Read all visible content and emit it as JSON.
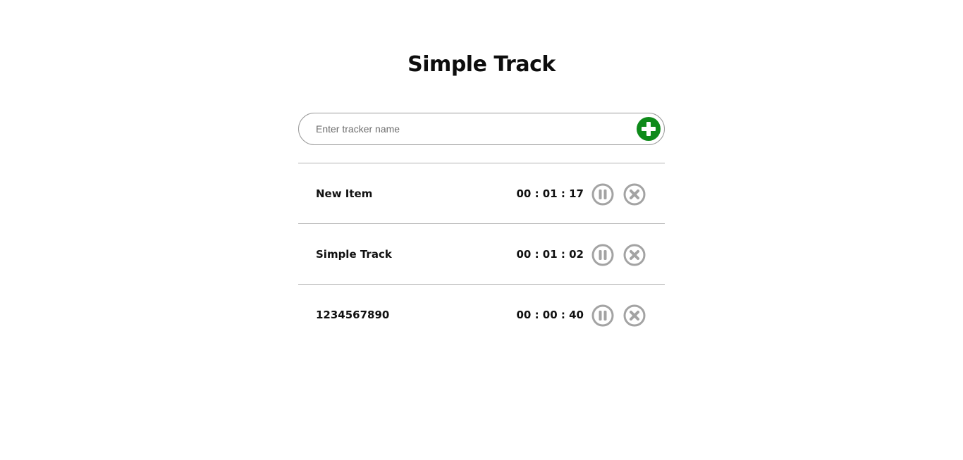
{
  "app": {
    "title": "Simple Track"
  },
  "form": {
    "placeholder": "Enter tracker name",
    "value": "",
    "add_icon": "plus-circle-icon",
    "add_color": "#0e8a1a"
  },
  "trackers": [
    {
      "name": "New Item",
      "time": "00 : 01 : 17",
      "pause_icon": "pause-circle-icon",
      "remove_icon": "close-circle-icon"
    },
    {
      "name": "Simple Track",
      "time": "00 : 01 : 02",
      "pause_icon": "pause-circle-icon",
      "remove_icon": "close-circle-icon"
    },
    {
      "name": "1234567890",
      "time": "00 : 00 : 40",
      "pause_icon": "pause-circle-icon",
      "remove_icon": "close-circle-icon"
    }
  ],
  "colors": {
    "icon_gray": "#a3a3a3",
    "divider": "#b3b3b3"
  }
}
